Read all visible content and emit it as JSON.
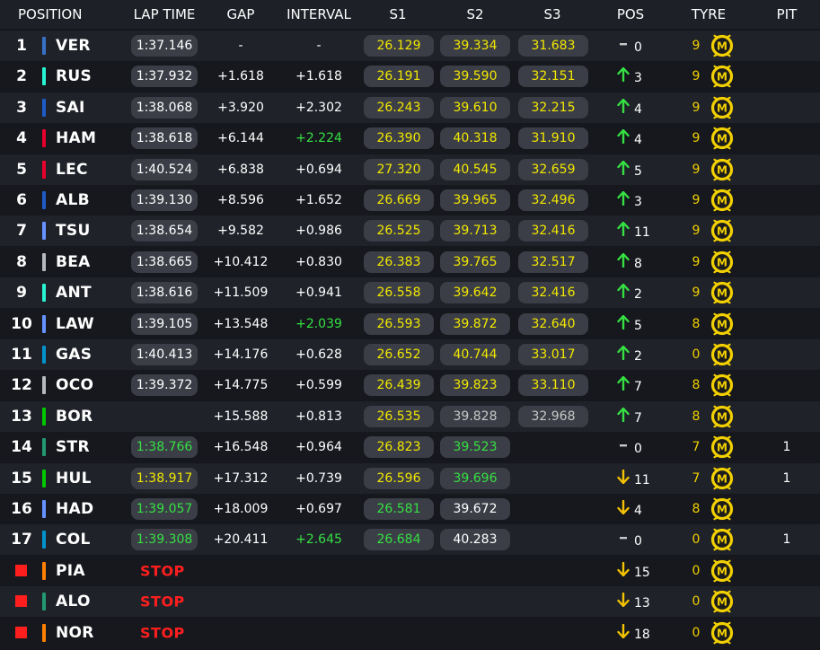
{
  "columns": {
    "position": "POSITION",
    "lap_time": "LAP TIME",
    "gap": "GAP",
    "interval": "INTERVAL",
    "s1": "S1",
    "s2": "S2",
    "s3": "S3",
    "pos": "POS",
    "tyre": "TYRE",
    "pit": "PIT"
  },
  "colors": {
    "purple": "#f2e700",
    "personal_best": "#36e043",
    "normal": "#ffffff",
    "muted": "#c8c8c8",
    "stop": "#ff1e1e",
    "tyre_medium": "#f2d000",
    "pos_up": "#36e043",
    "pos_down": "#f2c200",
    "pos_same": "#c8c8c8"
  },
  "icons": {
    "up": "up-arrow-icon",
    "down": "down-arrow-icon",
    "same": "dash-icon",
    "tyre": "medium-tyre-icon"
  },
  "rows": [
    {
      "pos": "1",
      "code": "VER",
      "team_color": "#3671c6",
      "lap_time": "1:37.146",
      "lap_color": "white",
      "gap": "-",
      "interval": "-",
      "interval_color": "white",
      "s1": "26.129",
      "s1_color": "yellow",
      "s2": "39.334",
      "s2_color": "yellow",
      "s3": "31.683",
      "s3_color": "yellow",
      "pos_dir": "same",
      "pos_delta": "0",
      "tyre_age": "9",
      "pit": ""
    },
    {
      "pos": "2",
      "code": "RUS",
      "team_color": "#27f4d2",
      "lap_time": "1:37.932",
      "lap_color": "white",
      "gap": "+1.618",
      "interval": "+1.618",
      "interval_color": "white",
      "s1": "26.191",
      "s1_color": "yellow",
      "s2": "39.590",
      "s2_color": "yellow",
      "s3": "32.151",
      "s3_color": "yellow",
      "pos_dir": "up",
      "pos_delta": "3",
      "tyre_age": "9",
      "pit": ""
    },
    {
      "pos": "3",
      "code": "SAI",
      "team_color": "#1e5bc6",
      "lap_time": "1:38.068",
      "lap_color": "white",
      "gap": "+3.920",
      "interval": "+2.302",
      "interval_color": "white",
      "s1": "26.243",
      "s1_color": "yellow",
      "s2": "39.610",
      "s2_color": "yellow",
      "s3": "32.215",
      "s3_color": "yellow",
      "pos_dir": "up",
      "pos_delta": "4",
      "tyre_age": "9",
      "pit": ""
    },
    {
      "pos": "4",
      "code": "HAM",
      "team_color": "#e8002d",
      "lap_time": "1:38.618",
      "lap_color": "white",
      "gap": "+6.144",
      "interval": "+2.224",
      "interval_color": "green",
      "s1": "26.390",
      "s1_color": "yellow",
      "s2": "40.318",
      "s2_color": "yellow",
      "s3": "31.910",
      "s3_color": "yellow",
      "pos_dir": "up",
      "pos_delta": "4",
      "tyre_age": "9",
      "pit": ""
    },
    {
      "pos": "5",
      "code": "LEC",
      "team_color": "#e8002d",
      "lap_time": "1:40.524",
      "lap_color": "white",
      "gap": "+6.838",
      "interval": "+0.694",
      "interval_color": "white",
      "s1": "27.320",
      "s1_color": "yellow",
      "s2": "40.545",
      "s2_color": "yellow",
      "s3": "32.659",
      "s3_color": "yellow",
      "pos_dir": "up",
      "pos_delta": "5",
      "tyre_age": "9",
      "pit": ""
    },
    {
      "pos": "6",
      "code": "ALB",
      "team_color": "#1e5bc6",
      "lap_time": "1:39.130",
      "lap_color": "white",
      "gap": "+8.596",
      "interval": "+1.652",
      "interval_color": "white",
      "s1": "26.669",
      "s1_color": "yellow",
      "s2": "39.965",
      "s2_color": "yellow",
      "s3": "32.496",
      "s3_color": "yellow",
      "pos_dir": "up",
      "pos_delta": "3",
      "tyre_age": "9",
      "pit": ""
    },
    {
      "pos": "7",
      "code": "TSU",
      "team_color": "#6692ff",
      "lap_time": "1:38.654",
      "lap_color": "white",
      "gap": "+9.582",
      "interval": "+0.986",
      "interval_color": "white",
      "s1": "26.525",
      "s1_color": "yellow",
      "s2": "39.713",
      "s2_color": "yellow",
      "s3": "32.416",
      "s3_color": "yellow",
      "pos_dir": "up",
      "pos_delta": "11",
      "tyre_age": "9",
      "pit": ""
    },
    {
      "pos": "8",
      "code": "BEA",
      "team_color": "#b6babd",
      "lap_time": "1:38.665",
      "lap_color": "white",
      "gap": "+10.412",
      "interval": "+0.830",
      "interval_color": "white",
      "s1": "26.383",
      "s1_color": "yellow",
      "s2": "39.765",
      "s2_color": "yellow",
      "s3": "32.517",
      "s3_color": "yellow",
      "pos_dir": "up",
      "pos_delta": "8",
      "tyre_age": "9",
      "pit": ""
    },
    {
      "pos": "9",
      "code": "ANT",
      "team_color": "#27f4d2",
      "lap_time": "1:38.616",
      "lap_color": "white",
      "gap": "+11.509",
      "interval": "+0.941",
      "interval_color": "white",
      "s1": "26.558",
      "s1_color": "yellow",
      "s2": "39.642",
      "s2_color": "yellow",
      "s3": "32.416",
      "s3_color": "yellow",
      "pos_dir": "up",
      "pos_delta": "2",
      "tyre_age": "9",
      "pit": ""
    },
    {
      "pos": "10",
      "code": "LAW",
      "team_color": "#6692ff",
      "lap_time": "1:39.105",
      "lap_color": "white",
      "gap": "+13.548",
      "interval": "+2.039",
      "interval_color": "green",
      "s1": "26.593",
      "s1_color": "yellow",
      "s2": "39.872",
      "s2_color": "yellow",
      "s3": "32.640",
      "s3_color": "yellow",
      "pos_dir": "up",
      "pos_delta": "5",
      "tyre_age": "8",
      "pit": ""
    },
    {
      "pos": "11",
      "code": "GAS",
      "team_color": "#0093cc",
      "lap_time": "1:40.413",
      "lap_color": "white",
      "gap": "+14.176",
      "interval": "+0.628",
      "interval_color": "white",
      "s1": "26.652",
      "s1_color": "yellow",
      "s2": "40.744",
      "s2_color": "yellow",
      "s3": "33.017",
      "s3_color": "yellow",
      "pos_dir": "up",
      "pos_delta": "2",
      "tyre_age": "0",
      "pit": ""
    },
    {
      "pos": "12",
      "code": "OCO",
      "team_color": "#b6babd",
      "lap_time": "1:39.372",
      "lap_color": "white",
      "gap": "+14.775",
      "interval": "+0.599",
      "interval_color": "white",
      "s1": "26.439",
      "s1_color": "yellow",
      "s2": "39.823",
      "s2_color": "yellow",
      "s3": "33.110",
      "s3_color": "yellow",
      "pos_dir": "up",
      "pos_delta": "7",
      "tyre_age": "8",
      "pit": ""
    },
    {
      "pos": "13",
      "code": "BOR",
      "team_color": "#00c800",
      "lap_time": "",
      "lap_color": "white",
      "gap": "+15.588",
      "interval": "+0.813",
      "interval_color": "white",
      "s1": "26.535",
      "s1_color": "yellow",
      "s2": "39.828",
      "s2_color": "grey",
      "s3": "32.968",
      "s3_color": "grey",
      "pos_dir": "up",
      "pos_delta": "7",
      "tyre_age": "8",
      "pit": ""
    },
    {
      "pos": "14",
      "code": "STR",
      "team_color": "#229971",
      "lap_time": "1:38.766",
      "lap_color": "green",
      "gap": "+16.548",
      "interval": "+0.964",
      "interval_color": "white",
      "s1": "26.823",
      "s1_color": "yellow",
      "s2": "39.523",
      "s2_color": "green",
      "s3": "",
      "s3_color": "white",
      "pos_dir": "same",
      "pos_delta": "0",
      "tyre_age": "7",
      "pit": "1"
    },
    {
      "pos": "15",
      "code": "HUL",
      "team_color": "#00c800",
      "lap_time": "1:38.917",
      "lap_color": "yellow",
      "gap": "+17.312",
      "interval": "+0.739",
      "interval_color": "white",
      "s1": "26.596",
      "s1_color": "yellow",
      "s2": "39.696",
      "s2_color": "green",
      "s3": "",
      "s3_color": "white",
      "pos_dir": "down",
      "pos_delta": "11",
      "tyre_age": "7",
      "pit": "1"
    },
    {
      "pos": "16",
      "code": "HAD",
      "team_color": "#6692ff",
      "lap_time": "1:39.057",
      "lap_color": "green",
      "gap": "+18.009",
      "interval": "+0.697",
      "interval_color": "white",
      "s1": "26.581",
      "s1_color": "green",
      "s2": "39.672",
      "s2_color": "white",
      "s3": "",
      "s3_color": "white",
      "pos_dir": "down",
      "pos_delta": "4",
      "tyre_age": "8",
      "pit": ""
    },
    {
      "pos": "17",
      "code": "COL",
      "team_color": "#0093cc",
      "lap_time": "1:39.308",
      "lap_color": "green",
      "gap": "+20.411",
      "interval": "+2.645",
      "interval_color": "green",
      "s1": "26.684",
      "s1_color": "green",
      "s2": "40.283",
      "s2_color": "white",
      "s3": "",
      "s3_color": "white",
      "pos_dir": "same",
      "pos_delta": "0",
      "tyre_age": "0",
      "pit": "1"
    },
    {
      "pos": "",
      "code": "PIA",
      "team_color": "#ff8000",
      "lap_time": "",
      "status": "STOP",
      "gap": "",
      "interval": "",
      "s1": "",
      "s2": "",
      "s3": "",
      "pos_dir": "down",
      "pos_delta": "15",
      "tyre_age": "0",
      "pit": ""
    },
    {
      "pos": "",
      "code": "ALO",
      "team_color": "#229971",
      "lap_time": "",
      "status": "STOP",
      "gap": "",
      "interval": "",
      "s1": "",
      "s2": "",
      "s3": "",
      "pos_dir": "down",
      "pos_delta": "13",
      "tyre_age": "0",
      "pit": ""
    },
    {
      "pos": "",
      "code": "NOR",
      "team_color": "#ff8000",
      "lap_time": "",
      "status": "STOP",
      "gap": "",
      "interval": "",
      "s1": "",
      "s2": "",
      "s3": "",
      "pos_dir": "down",
      "pos_delta": "18",
      "tyre_age": "0",
      "pit": ""
    }
  ]
}
